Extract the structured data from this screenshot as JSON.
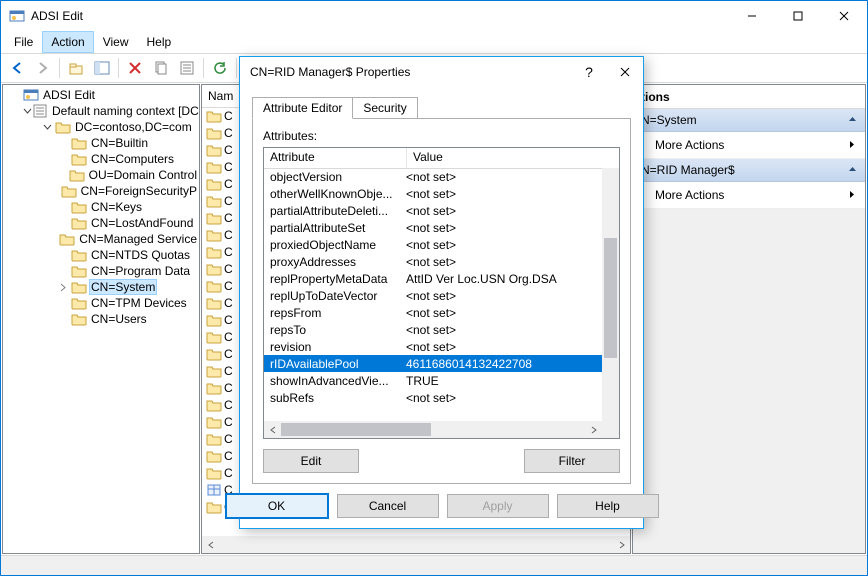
{
  "window": {
    "title": "ADSI Edit",
    "sys": {
      "min": "min",
      "max": "max",
      "close": "close"
    }
  },
  "menubar": {
    "items": [
      "File",
      "Action",
      "View",
      "Help"
    ],
    "selected": 1
  },
  "toolbar": {
    "buttons": [
      "back-arrow",
      "forward-arrow",
      "up-level",
      "show-hide-tree",
      "delete",
      "copy",
      "properties",
      "refresh",
      "help",
      "list-view",
      "detail-view"
    ]
  },
  "tree": {
    "root": "ADSI Edit",
    "nodes": [
      {
        "indent": 0,
        "expander": "none",
        "kind": "root",
        "label": "ADSI Edit"
      },
      {
        "indent": 1,
        "expander": "open",
        "kind": "ctx",
        "label": "Default naming context [DC"
      },
      {
        "indent": 2,
        "expander": "open",
        "kind": "folder",
        "label": "DC=contoso,DC=com"
      },
      {
        "indent": 3,
        "expander": "none",
        "kind": "folder",
        "label": "CN=Builtin"
      },
      {
        "indent": 3,
        "expander": "none",
        "kind": "folder",
        "label": "CN=Computers"
      },
      {
        "indent": 3,
        "expander": "none",
        "kind": "folder",
        "label": "OU=Domain Control"
      },
      {
        "indent": 3,
        "expander": "none",
        "kind": "folder",
        "label": "CN=ForeignSecurityP"
      },
      {
        "indent": 3,
        "expander": "none",
        "kind": "folder",
        "label": "CN=Keys"
      },
      {
        "indent": 3,
        "expander": "none",
        "kind": "folder",
        "label": "CN=LostAndFound"
      },
      {
        "indent": 3,
        "expander": "none",
        "kind": "folder",
        "label": "CN=Managed Service"
      },
      {
        "indent": 3,
        "expander": "none",
        "kind": "folder",
        "label": "CN=NTDS Quotas"
      },
      {
        "indent": 3,
        "expander": "none",
        "kind": "folder",
        "label": "CN=Program Data"
      },
      {
        "indent": 3,
        "expander": "closed",
        "kind": "folder",
        "label": "CN=System",
        "selected": true
      },
      {
        "indent": 3,
        "expander": "none",
        "kind": "folder",
        "label": "CN=TPM Devices"
      },
      {
        "indent": 3,
        "expander": "none",
        "kind": "folder",
        "label": "CN=Users"
      }
    ]
  },
  "list": {
    "header": "Nam",
    "row_prefix": "C",
    "row_count": 24,
    "special_rows": {
      "22": "container-icon",
      "23": "folder-icon"
    }
  },
  "actions": {
    "title": "tions",
    "sections": [
      {
        "label": "N=System",
        "items": [
          "More Actions"
        ]
      },
      {
        "label": "N=RID Manager$",
        "items": [
          "More Actions"
        ]
      }
    ]
  },
  "dialog": {
    "title": "CN=RID Manager$ Properties",
    "help": "?",
    "tabs": [
      "Attribute Editor",
      "Security"
    ],
    "active_tab": 0,
    "attributes_label": "Attributes:",
    "columns": [
      "Attribute",
      "Value"
    ],
    "rows": [
      {
        "a": "objectVersion",
        "v": "<not set>"
      },
      {
        "a": "otherWellKnownObje...",
        "v": "<not set>"
      },
      {
        "a": "partialAttributeDeleti...",
        "v": "<not set>"
      },
      {
        "a": "partialAttributeSet",
        "v": "<not set>"
      },
      {
        "a": "proxiedObjectName",
        "v": "<not set>"
      },
      {
        "a": "proxyAddresses",
        "v": "<not set>"
      },
      {
        "a": "replPropertyMetaData",
        "v": "AttID  Ver    Loc.USN              Org.DSA"
      },
      {
        "a": "replUpToDateVector",
        "v": "<not set>"
      },
      {
        "a": "repsFrom",
        "v": "<not set>"
      },
      {
        "a": "repsTo",
        "v": "<not set>"
      },
      {
        "a": "revision",
        "v": "<not set>"
      },
      {
        "a": "rIDAvailablePool",
        "v": "4611686014132422708",
        "selected": true
      },
      {
        "a": "showInAdvancedVie...",
        "v": "TRUE"
      },
      {
        "a": "subRefs",
        "v": "<not set>"
      }
    ],
    "buttons": {
      "edit": "Edit",
      "filter": "Filter",
      "ok": "OK",
      "cancel": "Cancel",
      "apply": "Apply",
      "help": "Help"
    }
  }
}
